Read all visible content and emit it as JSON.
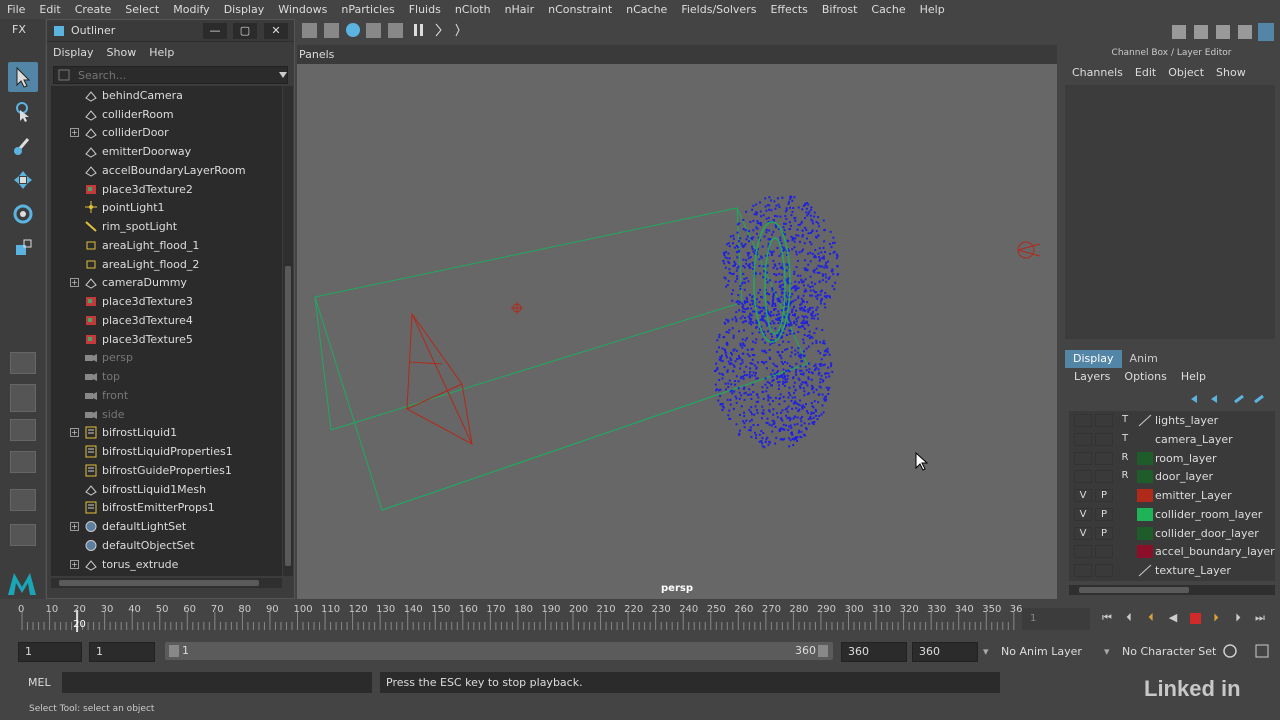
{
  "menubar": [
    "File",
    "Edit",
    "Create",
    "Select",
    "Modify",
    "Display",
    "Windows",
    "nParticles",
    "Fluids",
    "nCloth",
    "nHair",
    "nConstraint",
    "nCache",
    "Fields/Solvers",
    "Effects",
    "Bifrost",
    "Cache",
    "Help"
  ],
  "shelf": {
    "fx_label": "FX"
  },
  "outliner": {
    "title": "Outliner",
    "menu": [
      "Display",
      "Show",
      "Help"
    ],
    "search_placeholder": "Search...",
    "items": [
      {
        "label": "behindCamera",
        "icon": "transform-icon",
        "expand": false,
        "dim": false
      },
      {
        "label": "colliderRoom",
        "icon": "transform-icon",
        "expand": false,
        "dim": false
      },
      {
        "label": "colliderDoor",
        "icon": "transform-icon",
        "expand": true,
        "dim": false
      },
      {
        "label": "emitterDoorway",
        "icon": "transform-icon",
        "expand": false,
        "dim": false
      },
      {
        "label": "accelBoundaryLayerRoom",
        "icon": "transform-icon",
        "expand": false,
        "dim": false
      },
      {
        "label": "place3dTexture2",
        "icon": "texture-place-icon",
        "expand": false,
        "dim": false
      },
      {
        "label": "pointLight1",
        "icon": "point-light-icon",
        "expand": false,
        "dim": false
      },
      {
        "label": "rim_spotLight",
        "icon": "spot-light-icon",
        "expand": false,
        "dim": false
      },
      {
        "label": "areaLight_flood_1",
        "icon": "area-light-icon",
        "expand": false,
        "dim": false
      },
      {
        "label": "areaLight_flood_2",
        "icon": "area-light-icon",
        "expand": false,
        "dim": false
      },
      {
        "label": "cameraDummy",
        "icon": "transform-icon",
        "expand": true,
        "dim": false
      },
      {
        "label": "place3dTexture3",
        "icon": "texture-place-icon",
        "expand": false,
        "dim": false
      },
      {
        "label": "place3dTexture4",
        "icon": "texture-place-icon",
        "expand": false,
        "dim": false
      },
      {
        "label": "place3dTexture5",
        "icon": "texture-place-icon",
        "expand": false,
        "dim": false
      },
      {
        "label": "persp",
        "icon": "camera-icon",
        "expand": false,
        "dim": true
      },
      {
        "label": "top",
        "icon": "camera-icon",
        "expand": false,
        "dim": true
      },
      {
        "label": "front",
        "icon": "camera-icon",
        "expand": false,
        "dim": true
      },
      {
        "label": "side",
        "icon": "camera-icon",
        "expand": false,
        "dim": true
      },
      {
        "label": "bifrostLiquid1",
        "icon": "bifrost-icon",
        "expand": true,
        "dim": false
      },
      {
        "label": "bifrostLiquidProperties1",
        "icon": "bifrost-icon",
        "expand": false,
        "dim": false
      },
      {
        "label": "bifrostGuideProperties1",
        "icon": "bifrost-icon",
        "expand": false,
        "dim": false
      },
      {
        "label": "bifrostLiquid1Mesh",
        "icon": "transform-icon",
        "expand": false,
        "dim": false
      },
      {
        "label": "bifrostEmitterProps1",
        "icon": "bifrost-icon",
        "expand": false,
        "dim": false
      },
      {
        "label": "defaultLightSet",
        "icon": "set-icon",
        "expand": true,
        "dim": false
      },
      {
        "label": "defaultObjectSet",
        "icon": "set-icon",
        "expand": false,
        "dim": false
      },
      {
        "label": "torus_extrude",
        "icon": "transform-icon",
        "expand": true,
        "dim": false
      }
    ]
  },
  "viewport": {
    "panels_label": "Panels",
    "camera_label": "persp"
  },
  "channel_box": {
    "title": "Channel Box / Layer Editor",
    "menu": [
      "Channels",
      "Edit",
      "Object",
      "Show"
    ]
  },
  "layer_editor": {
    "tabs": [
      "Display",
      "Anim"
    ],
    "menu": [
      "Layers",
      "Options",
      "Help"
    ],
    "layers": [
      {
        "v": "",
        "p": "",
        "t": "T",
        "color": "none",
        "name": "lights_layer"
      },
      {
        "v": "",
        "p": "",
        "t": "T",
        "color": "#3a3a3a",
        "name": "camera_Layer"
      },
      {
        "v": "",
        "p": "",
        "t": "R",
        "color": "#1e5c2a",
        "name": "room_layer"
      },
      {
        "v": "",
        "p": "",
        "t": "R",
        "color": "#1e5c2a",
        "name": "door_layer"
      },
      {
        "v": "V",
        "p": "P",
        "t": "",
        "color": "#b02a1a",
        "name": "emitter_Layer"
      },
      {
        "v": "V",
        "p": "P",
        "t": "",
        "color": "#1fb357",
        "name": "collider_room_layer"
      },
      {
        "v": "V",
        "p": "P",
        "t": "",
        "color": "#1e5c2a",
        "name": "collider_door_layer"
      },
      {
        "v": "",
        "p": "",
        "t": "",
        "color": "#8c0f2a",
        "name": "accel_boundary_layer"
      },
      {
        "v": "",
        "p": "",
        "t": "",
        "color": "none",
        "name": "texture_Layer"
      }
    ]
  },
  "timeline": {
    "ticks": [
      "0",
      "10",
      "20",
      "30",
      "40",
      "50",
      "60",
      "70",
      "80",
      "90",
      "100",
      "110",
      "120",
      "130",
      "140",
      "150",
      "160",
      "170",
      "180",
      "190",
      "200",
      "210",
      "220",
      "230",
      "240",
      "250",
      "260",
      "270",
      "280",
      "290",
      "300",
      "310",
      "320",
      "330",
      "340",
      "350",
      "36"
    ],
    "current_marker": "20",
    "current_frame_field": "1"
  },
  "range": {
    "start": "1",
    "start_inner": "1",
    "slider_left": "1",
    "slider_right": "360",
    "end_inner": "360",
    "end": "360",
    "anim_layer": "No Anim Layer",
    "character_set": "No Character Set"
  },
  "command": {
    "lang": "MEL",
    "feedback": "Press the ESC key to stop playback."
  },
  "help_line": "Select Tool: select an object",
  "watermark": "Linked in"
}
